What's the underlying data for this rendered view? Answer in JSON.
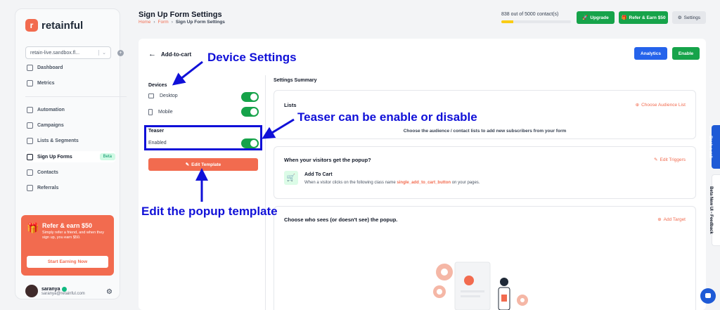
{
  "sidebar": {
    "logo_mark": "r",
    "logo_text": "retainful",
    "store": "retain-live.sandbox.fl...",
    "nav": [
      {
        "label": "Dashboard"
      },
      {
        "label": "Metrics"
      },
      {
        "label": "Automation"
      },
      {
        "label": "Campaigns"
      },
      {
        "label": "Lists & Segments"
      },
      {
        "label": "Sign Up Forms",
        "badge": "Beta"
      },
      {
        "label": "Contacts"
      },
      {
        "label": "Referrals"
      }
    ],
    "refer": {
      "title": "Refer & earn $50",
      "desc": "Simply refer a friend, and when they sign up, you earn $50.",
      "button": "Start Earning Now"
    },
    "user": {
      "name": "saranya",
      "email": "saranya@retainful.com"
    }
  },
  "header": {
    "title": "Sign Up Form Settings",
    "breadcrumb": [
      "Home",
      "Form",
      "Sign Up Form Settings"
    ],
    "crumb_sep": "›",
    "contacts": "838 out of 5000 contact(s)",
    "contacts_fraction": 0.1676,
    "upgrade": "Upgrade",
    "refer": "Refer & Earn $50",
    "settings": "Settings"
  },
  "main": {
    "back": "Add-to-cart",
    "analytics": "Analytics",
    "enable": "Enable",
    "devices_label": "Devices",
    "desktop": "Desktop",
    "mobile": "Mobile",
    "teaser_label": "Teaser",
    "teaser_enabled": "Enabled",
    "edit_template": "Edit Template",
    "summary_label": "Settings Summary",
    "lists": {
      "title": "Lists",
      "action": "Choose Audience List",
      "desc": "Choose the audience / contact lists to add new subscribers from your form"
    },
    "trigger": {
      "title": "When your visitors get the popup?",
      "action": "Edit Triggers",
      "item_title": "Add To Cart",
      "item_desc": "When a visitor clicks on the following class name",
      "class_name": "single_add_to_cart_button",
      "item_desc_end": "on your pages."
    },
    "target": {
      "title": "Choose who sees (or doesn't see) the popup.",
      "action": "Add Target"
    }
  },
  "right_tabs": {
    "book_call": "Book a call",
    "feedback": "Beta New UI - Feedback"
  },
  "annotations": {
    "device": "Device Settings",
    "teaser": "Teaser can be enable or disable",
    "template": "Edit the popup template"
  },
  "colors": {
    "brand": "#f26b4f",
    "green": "#16a34a",
    "blue": "#1e5ad6",
    "annotation": "#1010d8"
  }
}
